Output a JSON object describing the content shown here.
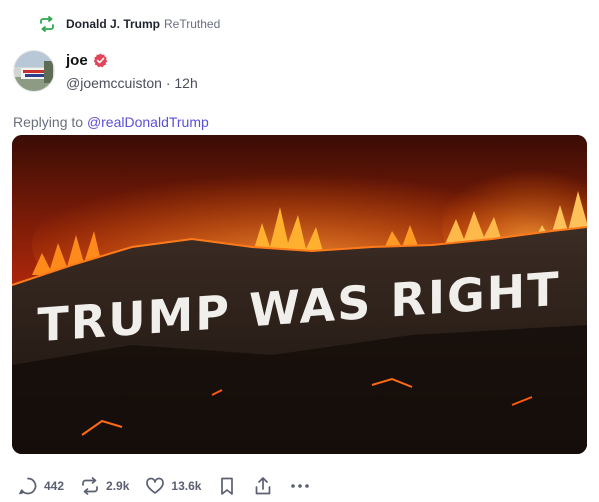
{
  "retruth": {
    "icon": "retruth-icon",
    "user_name": "Donald J. Trump",
    "label": "ReTruthed"
  },
  "author": {
    "avatar_icon": "avatar",
    "name": "joe",
    "verified_icon": "verified-badge-icon",
    "handle": "@joemccuiston",
    "separator": "·",
    "time": "12h"
  },
  "reply": {
    "prefix": "Replying to",
    "target": "@realDonaldTrump"
  },
  "media": {
    "sign_text": "TRUMP WAS RIGHT"
  },
  "actions": {
    "replies": "442",
    "retruths": "2.9k",
    "likes": "13.6k"
  },
  "colors": {
    "accent": "#5a50d6",
    "retruth_green": "#2fa84f",
    "verified": "#e0455a"
  }
}
